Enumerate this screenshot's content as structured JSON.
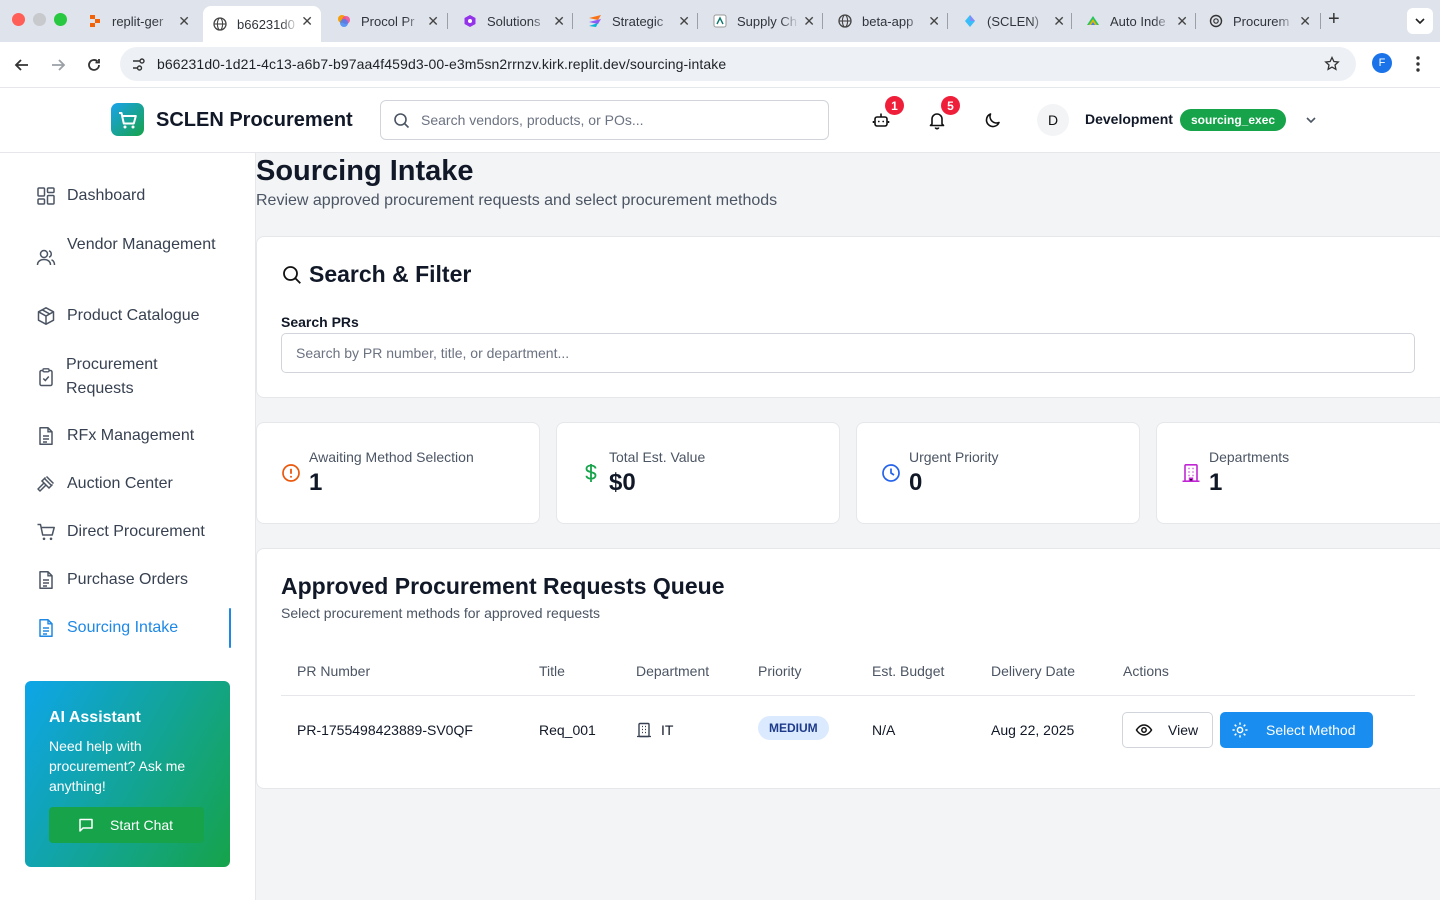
{
  "browser": {
    "tabs": [
      {
        "title": "replit-ger"
      },
      {
        "title": "b66231d0"
      },
      {
        "title": "Procol Pr"
      },
      {
        "title": "Solutions"
      },
      {
        "title": "Strategic"
      },
      {
        "title": "Supply Ch"
      },
      {
        "title": "beta-app"
      },
      {
        "title": "(SCLEN)"
      },
      {
        "title": "Auto Inde"
      },
      {
        "title": "Procurem"
      }
    ],
    "url": "b66231d0-1d21-4c13-a6b7-b97aa4f459d3-00-e3m5sn2rrnzv.kirk.replit.dev/sourcing-intake",
    "profile_initial": "F"
  },
  "header": {
    "brand": "SCLEN Procurement",
    "search_placeholder": "Search vendors, products, or POs...",
    "robot_badge": "1",
    "bell_badge": "5",
    "avatar_initial": "D",
    "user_name": "Development",
    "role": "sourcing_exec"
  },
  "sidebar": {
    "items": [
      {
        "label": "Dashboard"
      },
      {
        "label": "Vendor Management"
      },
      {
        "label": "Product Catalogue"
      },
      {
        "label": "Procurement Requests"
      },
      {
        "label": "RFx Management"
      },
      {
        "label": "Auction Center"
      },
      {
        "label": "Direct Procurement"
      },
      {
        "label": "Purchase Orders"
      },
      {
        "label": "Sourcing Intake"
      }
    ],
    "ai": {
      "title": "AI Assistant",
      "desc": "Need help with procurement? Ask me anything!",
      "button": "Start Chat"
    }
  },
  "page": {
    "title": "Sourcing Intake",
    "subtitle": "Review approved procurement requests and select procurement methods"
  },
  "filter": {
    "title": "Search & Filter",
    "label": "Search PRs",
    "placeholder": "Search by PR number, title, or department..."
  },
  "stats": [
    {
      "label": "Awaiting Method Selection",
      "value": "1",
      "icon": "alert-circle-icon",
      "color": "#ea580c"
    },
    {
      "label": "Total Est. Value",
      "value": "$0",
      "icon": "dollar-icon",
      "color": "#16a34a"
    },
    {
      "label": "Urgent Priority",
      "value": "0",
      "icon": "clock-icon",
      "color": "#2563eb"
    },
    {
      "label": "Departments",
      "value": "1",
      "icon": "building-icon",
      "color": "#c026d3"
    }
  ],
  "queue": {
    "title": "Approved Procurement Requests Queue",
    "subtitle": "Select procurement methods for approved requests",
    "columns": [
      "PR Number",
      "Title",
      "Department",
      "Priority",
      "Est. Budget",
      "Delivery Date",
      "Actions"
    ],
    "rows": [
      {
        "pr_number": "PR-1755498423889-SV0QF",
        "title": "Req_001",
        "department": "IT",
        "priority": "MEDIUM",
        "budget": "N/A",
        "delivery": "Aug 22, 2025",
        "view_label": "View",
        "select_label": "Select Method"
      }
    ]
  },
  "colors": {
    "accent": "#1e88e5",
    "success": "#16a34a",
    "badge": "#ef1f3a"
  }
}
